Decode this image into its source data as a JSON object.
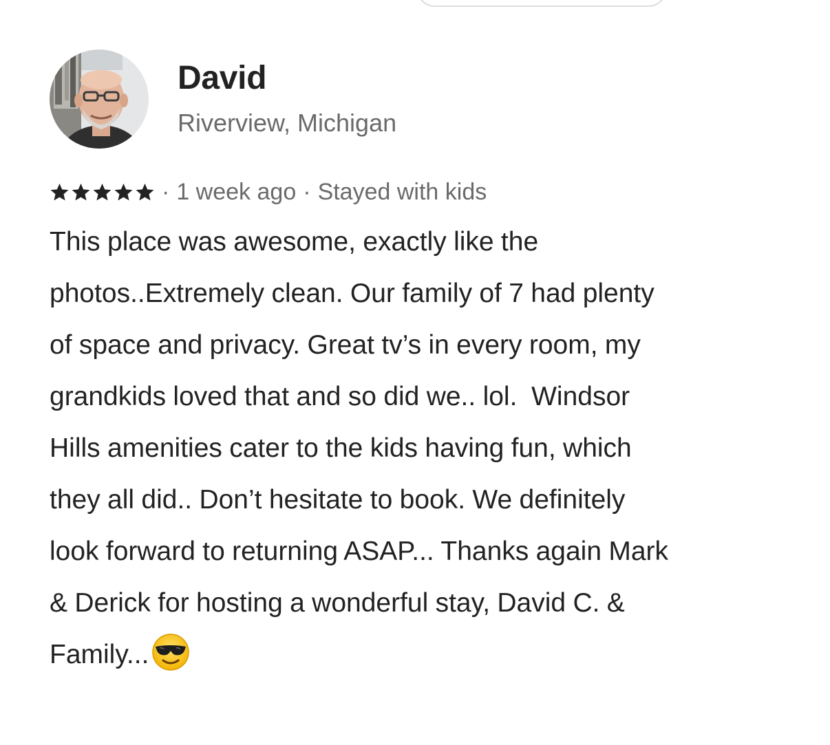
{
  "review": {
    "reviewer": {
      "name": "David",
      "location": "Riverview, Michigan",
      "avatar_icon": "reviewer-photo"
    },
    "rating": 5,
    "rating_color": "#222222",
    "meta": {
      "separator": "·",
      "date": "1 week ago",
      "stay_type": "Stayed with kids"
    },
    "text": "This place was awesome, exactly like the\nphotos..Extremely clean. Our family of 7 had plenty\nof space and privacy. Great tv’s in every room, my\ngrandkids loved that and so did we.. lol.  Windsor\nHills amenities cater to the kids having fun, which\nthey all did.. Don’t hesitate to book. We definitely\nlook forward to returning ASAP... Thanks again Mark\n& Derick for hosting a wonderful stay, David C. &\nFamily...",
    "trailing_emoji": "sunglasses-emoji"
  },
  "colors": {
    "primary_text": "#222222",
    "secondary_text": "#6a6a6a",
    "border": "#dddddd"
  }
}
